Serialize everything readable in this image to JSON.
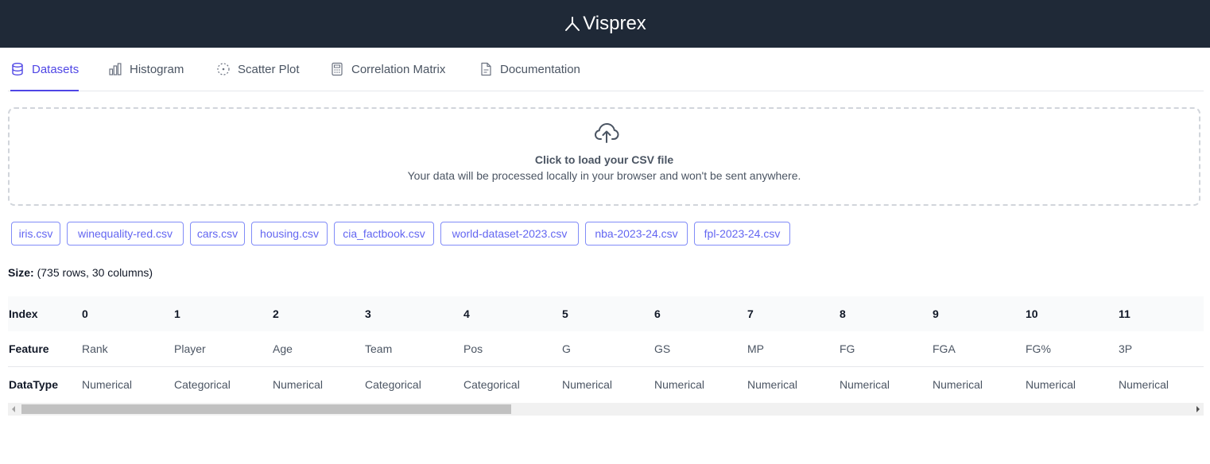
{
  "app": {
    "title": "Visprex",
    "logo_icon": "visprex-logo-icon"
  },
  "tabs": [
    {
      "label": "Datasets",
      "icon": "database-icon",
      "active": true
    },
    {
      "label": "Histogram",
      "icon": "bar-chart-icon",
      "active": false
    },
    {
      "label": "Scatter Plot",
      "icon": "scatter-icon",
      "active": false
    },
    {
      "label": "Correlation Matrix",
      "icon": "calculator-icon",
      "active": false
    },
    {
      "label": "Documentation",
      "icon": "document-icon",
      "active": false
    }
  ],
  "upload": {
    "icon": "cloud-upload-icon",
    "title": "Click to load your CSV file",
    "subtitle": "Your data will be processed locally in your browser and won't be sent anywhere."
  },
  "datasets": [
    "iris.csv",
    "winequality-red.csv",
    "cars.csv",
    "housing.csv",
    "cia_factbook.csv",
    "world-dataset-2023.csv",
    "nba-2023-24.csv",
    "fpl-2023-24.csv"
  ],
  "size": {
    "label": "Size:",
    "value": "(735 rows, 30 columns)"
  },
  "table": {
    "row_labels": [
      "Index",
      "Feature",
      "DataType"
    ],
    "index": [
      "0",
      "1",
      "2",
      "3",
      "4",
      "5",
      "6",
      "7",
      "8",
      "9",
      "10",
      "11"
    ],
    "features": [
      "Rank",
      "Player",
      "Age",
      "Team",
      "Pos",
      "G",
      "GS",
      "MP",
      "FG",
      "FGA",
      "FG%",
      "3P"
    ],
    "datatypes": [
      "Numerical",
      "Categorical",
      "Numerical",
      "Categorical",
      "Categorical",
      "Numerical",
      "Numerical",
      "Numerical",
      "Numerical",
      "Numerical",
      "Numerical",
      "Numerical"
    ]
  },
  "colors": {
    "header_bg": "#1f2937",
    "accent": "#4f46e5",
    "chip_border": "#818cf8"
  }
}
